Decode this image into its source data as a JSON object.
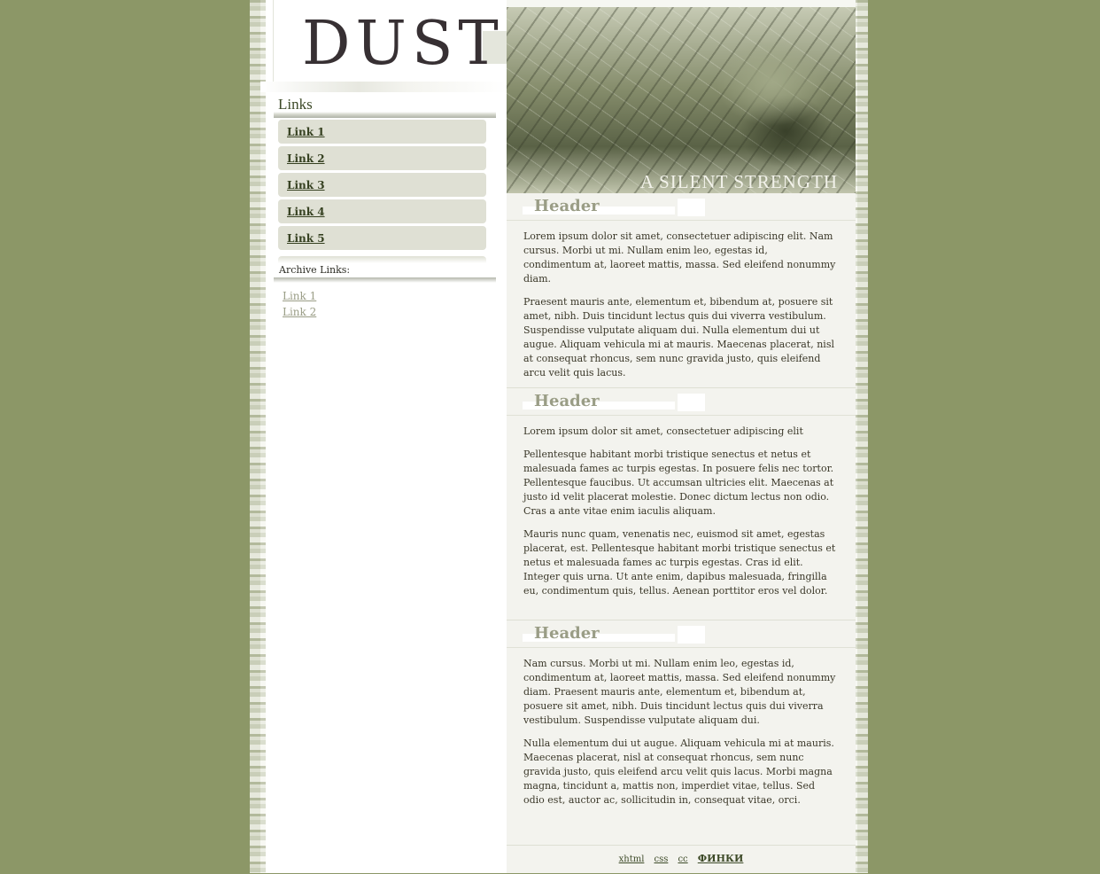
{
  "site": {
    "logo": "DUST",
    "hero_caption": "A SILENT STRENGTH"
  },
  "sidebar": {
    "links_title": "Links",
    "nav": [
      "Link 1",
      "Link 2",
      "Link 3",
      "Link 4",
      "Link 5"
    ],
    "archive_title": "Archive Links:",
    "archive": [
      "Link 1",
      "Link 2"
    ]
  },
  "articles": [
    {
      "header": "Header",
      "paragraphs": [
        "Lorem ipsum dolor sit amet, consectetuer adipiscing elit. Nam cursus. Morbi ut mi. Nullam enim leo, egestas id, condimentum at, laoreet mattis, massa. Sed eleifend nonummy diam.",
        "Praesent mauris ante, elementum et, bibendum at, posuere sit amet, nibh. Duis tincidunt lectus quis dui viverra vestibulum. Suspendisse vulputate aliquam dui. Nulla elementum dui ut augue. Aliquam vehicula mi at mauris. Maecenas placerat, nisl at consequat rhoncus, sem nunc gravida justo, quis eleifend arcu velit quis lacus."
      ]
    },
    {
      "header": "Header",
      "paragraphs": [
        "Lorem ipsum dolor sit amet, consectetuer adipiscing elit",
        "Pellentesque habitant morbi tristique senectus et netus et malesuada fames ac turpis egestas. In posuere felis nec tortor. Pellentesque faucibus. Ut accumsan ultricies elit. Maecenas at justo id velit placerat molestie. Donec dictum lectus non odio. Cras a ante vitae enim iaculis aliquam.",
        "Mauris nunc quam, venenatis nec, euismod sit amet, egestas placerat, est. Pellentesque habitant morbi tristique senectus et netus et malesuada fames ac turpis egestas. Cras id elit. Integer quis urna. Ut ante enim, dapibus malesuada, fringilla eu, condimentum quis, tellus. Aenean porttitor eros vel dolor."
      ]
    },
    {
      "header": "Header",
      "paragraphs": [
        "Nam cursus. Morbi ut mi. Nullam enim leo, egestas id, condimentum at, laoreet mattis, massa. Sed eleifend nonummy diam. Praesent mauris ante, elementum et, bibendum at, posuere sit amet, nibh. Duis tincidunt lectus quis dui viverra vestibulum. Suspendisse vulputate aliquam dui.",
        "Nulla elementum dui ut augue. Aliquam vehicula mi at mauris. Maecenas placerat, nisl at consequat rhoncus, sem nunc gravida justo, quis eleifend arcu velit quis lacus. Morbi magna magna, tincidunt a, mattis non, imperdiet vitae, tellus. Sed odio est, auctor ac, sollicitudin in, consequat vitae, orci."
      ]
    }
  ],
  "footer": {
    "links": [
      "xhtml",
      "css",
      "cc",
      "ФИНКИ"
    ]
  },
  "colors": {
    "background": "#8c9767",
    "nav_item": "#dfe0d4",
    "link_text": "#354020",
    "header_text": "#9a9d86",
    "content_bg": "#f3f3ee"
  }
}
